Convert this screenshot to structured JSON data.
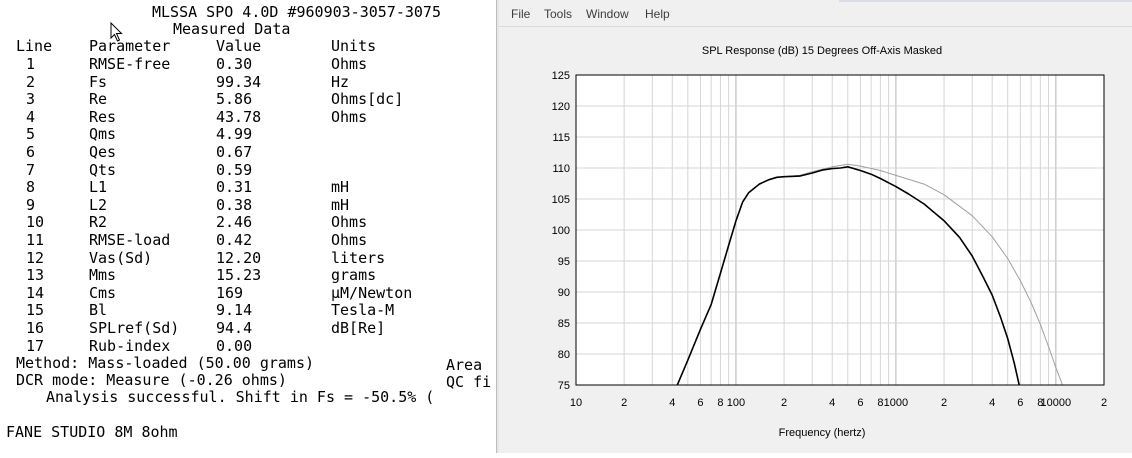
{
  "report": {
    "title": "MLSSA SPO 4.0D #960903-3057-3075",
    "subtitle": "Measured Data",
    "headers": {
      "line": "Line",
      "parameter": "Parameter",
      "value": "Value",
      "units": "Units"
    },
    "rows": [
      {
        "line": "1",
        "param": "RMSE-free",
        "value": "0.30",
        "units": "Ohms"
      },
      {
        "line": "2",
        "param": "Fs",
        "value": "99.34",
        "units": "Hz"
      },
      {
        "line": "3",
        "param": "Re",
        "value": "5.86",
        "units": "Ohms[dc]"
      },
      {
        "line": "4",
        "param": "Res",
        "value": "43.78",
        "units": "Ohms"
      },
      {
        "line": "5",
        "param": "Qms",
        "value": "4.99",
        "units": ""
      },
      {
        "line": "6",
        "param": "Qes",
        "value": "0.67",
        "units": ""
      },
      {
        "line": "7",
        "param": "Qts",
        "value": "0.59",
        "units": ""
      },
      {
        "line": "8",
        "param": "L1",
        "value": "0.31",
        "units": "mH"
      },
      {
        "line": "9",
        "param": "L2",
        "value": "0.38",
        "units": "mH"
      },
      {
        "line": "10",
        "param": "R2",
        "value": "2.46",
        "units": "Ohms"
      },
      {
        "line": "11",
        "param": "RMSE-load",
        "value": "0.42",
        "units": "Ohms"
      },
      {
        "line": "12",
        "param": "Vas(Sd)",
        "value": "12.20",
        "units": "liters"
      },
      {
        "line": "13",
        "param": "Mms",
        "value": "15.23",
        "units": "grams"
      },
      {
        "line": "14",
        "param": "Cms",
        "value": "169",
        "units": "µM/Newton"
      },
      {
        "line": "15",
        "param": "Bl",
        "value": "9.14",
        "units": "Tesla-M"
      },
      {
        "line": "16",
        "param": "SPLref(Sd)",
        "value": "94.4",
        "units": "dB[Re]"
      },
      {
        "line": "17",
        "param": "Rub-index",
        "value": "0.00",
        "units": ""
      }
    ],
    "method": "Method: Mass-loaded (50.00 grams)",
    "area": "Area",
    "dcr": "DCR mode: Measure (-0.26 ohms)",
    "qc": "QC fi",
    "analysis": "Analysis successful. Shift in Fs = -50.5% (",
    "speaker": "FANE STUDIO 8M 8ohm"
  },
  "window": {
    "menu": [
      "File",
      "Tools",
      "Window",
      "Help"
    ]
  },
  "chart_data": {
    "type": "line",
    "title": "SPL Response (dB)   15 Degrees Off-Axis   Masked",
    "xlabel": "Frequency (hertz)",
    "ylabel": "",
    "x_scale": "log",
    "xlim": [
      10,
      20000
    ],
    "ylim": [
      75,
      125
    ],
    "yticks": [
      "125",
      "120",
      "115",
      "110",
      "105",
      "100",
      "95",
      "90",
      "85",
      "80",
      "75"
    ],
    "xticks": [
      {
        "value": 10,
        "label": "10"
      },
      {
        "value": 20,
        "label": "2"
      },
      {
        "value": 40,
        "label": "4"
      },
      {
        "value": 60,
        "label": "6"
      },
      {
        "value": 80,
        "label": "8"
      },
      {
        "value": 100,
        "label": "100"
      },
      {
        "value": 200,
        "label": "2"
      },
      {
        "value": 400,
        "label": "4"
      },
      {
        "value": 600,
        "label": "6"
      },
      {
        "value": 800,
        "label": "8"
      },
      {
        "value": 1000,
        "label": "1000"
      },
      {
        "value": 2000,
        "label": "2"
      },
      {
        "value": 4000,
        "label": "4"
      },
      {
        "value": 6000,
        "label": "6"
      },
      {
        "value": 8000,
        "label": "8"
      },
      {
        "value": 10000,
        "label": "10000"
      },
      {
        "value": 20000,
        "label": "2"
      }
    ],
    "grid": true,
    "series": [
      {
        "color": "#000000",
        "points": [
          [
            43,
            75
          ],
          [
            50,
            79
          ],
          [
            60,
            84
          ],
          [
            70,
            88
          ],
          [
            80,
            93
          ],
          [
            90,
            97.5
          ],
          [
            100,
            101.5
          ],
          [
            110,
            104.5
          ],
          [
            120,
            106
          ],
          [
            140,
            107.4
          ],
          [
            160,
            108.1
          ],
          [
            180,
            108.5
          ],
          [
            200,
            108.6
          ],
          [
            250,
            108.7
          ],
          [
            300,
            109.2
          ],
          [
            350,
            109.7
          ],
          [
            400,
            109.9
          ],
          [
            450,
            110.0
          ],
          [
            500,
            110.2
          ],
          [
            600,
            109.6
          ],
          [
            700,
            109.0
          ],
          [
            800,
            108.3
          ],
          [
            1000,
            107.0
          ],
          [
            1200,
            105.8
          ],
          [
            1500,
            104.2
          ],
          [
            2000,
            101.5
          ],
          [
            2500,
            98.8
          ],
          [
            3000,
            95.8
          ],
          [
            3500,
            92.5
          ],
          [
            4000,
            89.5
          ],
          [
            4500,
            86.0
          ],
          [
            5000,
            82.5
          ],
          [
            5500,
            78.5
          ],
          [
            5900,
            75
          ]
        ]
      },
      {
        "color": "#a0a0a0",
        "points": [
          [
            43,
            75
          ],
          [
            50,
            79
          ],
          [
            60,
            84
          ],
          [
            70,
            88
          ],
          [
            80,
            93
          ],
          [
            90,
            97.5
          ],
          [
            100,
            101.5
          ],
          [
            110,
            104.5
          ],
          [
            120,
            106
          ],
          [
            140,
            107.4
          ],
          [
            160,
            108.1
          ],
          [
            180,
            108.5
          ],
          [
            200,
            108.6
          ],
          [
            250,
            108.8
          ],
          [
            300,
            109.4
          ],
          [
            400,
            110.2
          ],
          [
            500,
            110.6
          ],
          [
            600,
            110.3
          ],
          [
            800,
            109.6
          ],
          [
            1000,
            108.8
          ],
          [
            1500,
            107.4
          ],
          [
            2000,
            105.7
          ],
          [
            3000,
            102.3
          ],
          [
            4000,
            98.9
          ],
          [
            5000,
            95.4
          ],
          [
            6000,
            91.8
          ],
          [
            7000,
            88.3
          ],
          [
            8000,
            84.8
          ],
          [
            9000,
            81.2
          ],
          [
            10000,
            77.8
          ],
          [
            11000,
            75
          ]
        ]
      }
    ]
  }
}
